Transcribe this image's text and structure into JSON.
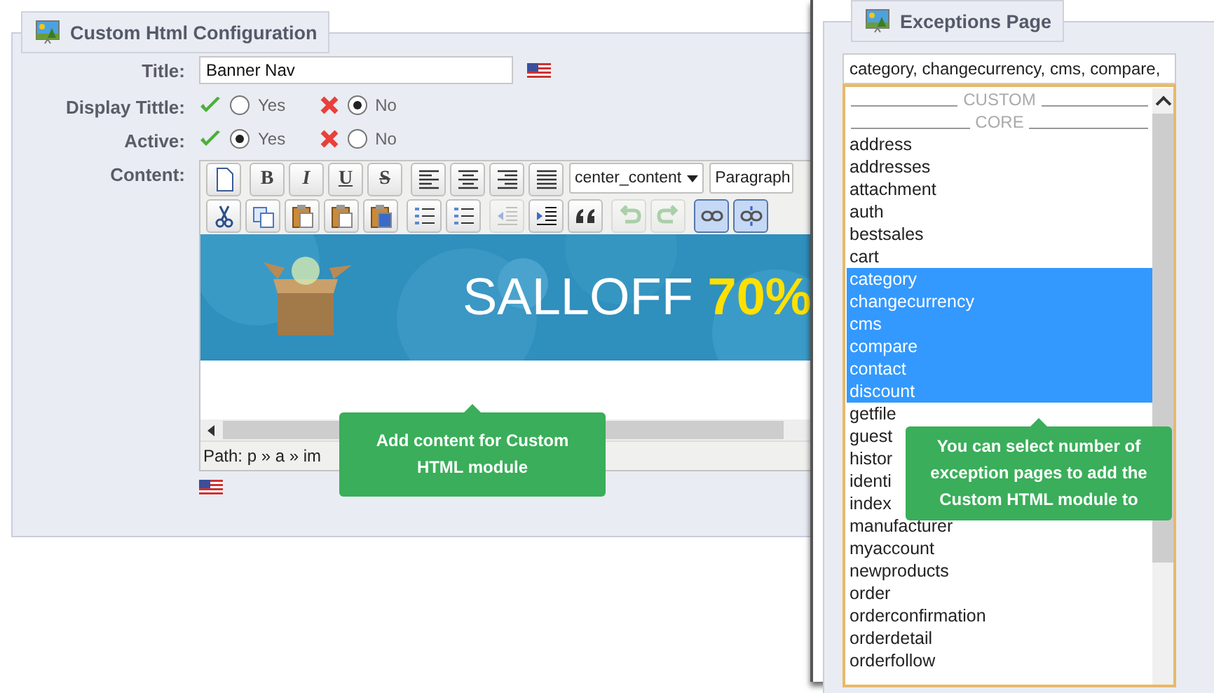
{
  "config_panel": {
    "title": "Custom Html Configuration",
    "fields": [
      {
        "kind": "text",
        "label": "Title:",
        "value": "Banner Nav"
      },
      {
        "kind": "toggle",
        "label": "Display Tittle:",
        "options": [
          {
            "label": "Yes",
            "selected": false
          },
          {
            "label": "No",
            "selected": true
          }
        ]
      },
      {
        "kind": "toggle",
        "label": "Active:",
        "options": [
          {
            "label": "Yes",
            "selected": true
          },
          {
            "label": "No",
            "selected": false
          }
        ]
      }
    ],
    "content_label": "Content:",
    "editor": {
      "toolbar_rows": [
        [
          {
            "kind": "new",
            "pressed": false,
            "disabled": false
          },
          {
            "kind": "bold",
            "label": "B",
            "pressed": false,
            "disabled": false
          },
          {
            "kind": "italic",
            "label": "I",
            "pressed": false,
            "disabled": false
          },
          {
            "kind": "underline",
            "label": "U",
            "pressed": false,
            "disabled": false
          },
          {
            "kind": "strike",
            "label": "S",
            "pressed": false,
            "disabled": false
          },
          {
            "kind": "align-left",
            "pressed": false,
            "disabled": false
          },
          {
            "kind": "align-center",
            "pressed": false,
            "disabled": false
          },
          {
            "kind": "align-right",
            "pressed": false,
            "disabled": false
          },
          {
            "kind": "justify",
            "pressed": false,
            "disabled": false
          },
          {
            "kind": "dropdown",
            "label": "center_content",
            "pressed": false,
            "disabled": false
          },
          {
            "kind": "select",
            "label": "Paragraph",
            "pressed": false,
            "disabled": false
          }
        ],
        [
          {
            "kind": "cut",
            "pressed": false,
            "disabled": false
          },
          {
            "kind": "copy",
            "pressed": false,
            "disabled": false
          },
          {
            "kind": "paste",
            "pressed": false,
            "disabled": false
          },
          {
            "kind": "paste-text",
            "pressed": false,
            "disabled": false
          },
          {
            "kind": "paste-word",
            "pressed": false,
            "disabled": false
          },
          {
            "kind": "bullets",
            "pressed": false,
            "disabled": false
          },
          {
            "kind": "numbers",
            "pressed": false,
            "disabled": false
          },
          {
            "kind": "outdent",
            "pressed": false,
            "disabled": true
          },
          {
            "kind": "indent",
            "pressed": false,
            "disabled": false
          },
          {
            "kind": "quote",
            "pressed": false,
            "disabled": false
          },
          {
            "kind": "undo",
            "pressed": false,
            "disabled": true
          },
          {
            "kind": "redo",
            "pressed": false,
            "disabled": true
          },
          {
            "kind": "link",
            "pressed": true,
            "disabled": false
          },
          {
            "kind": "unlink",
            "pressed": true,
            "disabled": false
          }
        ]
      ],
      "banner": {
        "text": "SALLOFF",
        "highlight": "70%"
      },
      "path": "Path: p » a » im",
      "tooltip": "Add content for Custom HTML module"
    }
  },
  "exceptions_panel": {
    "title": "Exceptions Page",
    "value": "category, changecurrency, cms, compare,",
    "groups": [
      "CUSTOM",
      "CORE"
    ],
    "pages": [
      {
        "label": "address",
        "selected": false
      },
      {
        "label": "addresses",
        "selected": false
      },
      {
        "label": "attachment",
        "selected": false
      },
      {
        "label": "auth",
        "selected": false
      },
      {
        "label": "bestsales",
        "selected": false
      },
      {
        "label": "cart",
        "selected": false
      },
      {
        "label": "category",
        "selected": true
      },
      {
        "label": "changecurrency",
        "selected": true
      },
      {
        "label": "cms",
        "selected": true
      },
      {
        "label": "compare",
        "selected": true
      },
      {
        "label": "contact",
        "selected": true
      },
      {
        "label": "discount",
        "selected": true
      },
      {
        "label": "getfile",
        "selected": false
      },
      {
        "label": "guest",
        "selected": false
      },
      {
        "label": "histor",
        "selected": false
      },
      {
        "label": "identi",
        "selected": false
      },
      {
        "label": "index",
        "selected": false
      },
      {
        "label": "manufacturer",
        "selected": false
      },
      {
        "label": "myaccount",
        "selected": false
      },
      {
        "label": "newproducts",
        "selected": false
      },
      {
        "label": "order",
        "selected": false
      },
      {
        "label": "orderconfirmation",
        "selected": false
      },
      {
        "label": "orderdetail",
        "selected": false
      },
      {
        "label": "orderfollow",
        "selected": false
      }
    ],
    "tooltip": "You can select number of exception pages to add the Custom HTML module to"
  }
}
